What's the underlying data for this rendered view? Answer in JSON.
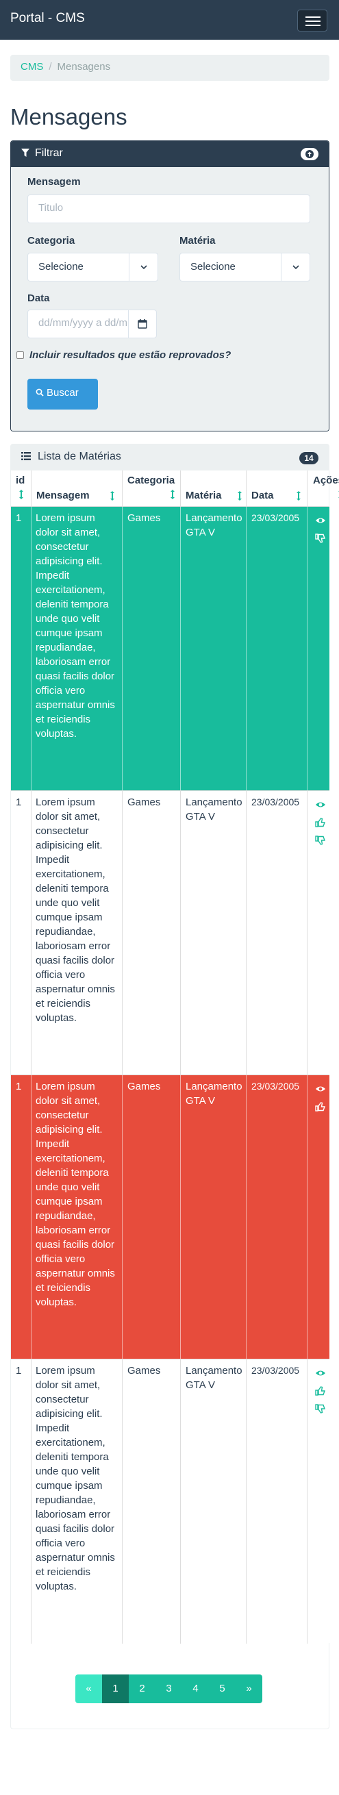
{
  "navbar": {
    "brand": "Portal - CMS"
  },
  "breadcrumb": {
    "root": "CMS",
    "separator": "/",
    "current": "Mensagens"
  },
  "page": {
    "title": "Mensagens"
  },
  "filter": {
    "title": "Filtrar",
    "message_label": "Mensagem",
    "message_placeholder": "Titulo",
    "category_label": "Categoria",
    "category_value": "Selecione",
    "subject_label": "Matéria",
    "subject_value": "Selecione",
    "date_label": "Data",
    "date_placeholder": "dd/mm/yyyy a dd/m",
    "include_rejected_label": "Incluir resultados que estão reprovados?",
    "search_button": "Buscar"
  },
  "list": {
    "title": "Lista de Matérias",
    "count": "14",
    "columns": [
      "id",
      "Mensagem",
      "Categoria",
      "Matéria",
      "Data",
      "Ações"
    ],
    "rows": [
      {
        "status": "approved",
        "id": "1",
        "message": "Lorem ipsum dolor sit amet, consectetur adipisicing elit. Impedit exercitationem, deleniti tempora unde quo velit cumque ipsam repudiandae, laboriosam error quasi facilis dolor officia vero aspernatur omnis et reiciendis voluptas.",
        "category": "Games",
        "subject": "Lançamento GTA V",
        "date": "23/03/2005",
        "actions": [
          "eye-icon",
          "thumbs-down-icon"
        ]
      },
      {
        "status": "pending",
        "id": "1",
        "message": "Lorem ipsum dolor sit amet, consectetur adipisicing elit. Impedit exercitationem, deleniti tempora unde quo velit cumque ipsam repudiandae, laboriosam error quasi facilis dolor officia vero aspernatur omnis et reiciendis voluptas.",
        "category": "Games",
        "subject": "Lançamento GTA V",
        "date": "23/03/2005",
        "actions": [
          "eye-icon",
          "thumbs-up-icon",
          "thumbs-down-icon"
        ]
      },
      {
        "status": "rejected",
        "id": "1",
        "message": "Lorem ipsum dolor sit amet, consectetur adipisicing elit. Impedit exercitationem, deleniti tempora unde quo velit cumque ipsam repudiandae, laboriosam error quasi facilis dolor officia vero aspernatur omnis et reiciendis voluptas.",
        "category": "Games",
        "subject": "Lançamento GTA V",
        "date": "23/03/2005",
        "actions": [
          "eye-icon",
          "thumbs-up-icon"
        ]
      },
      {
        "status": "pending",
        "id": "1",
        "message": "Lorem ipsum dolor sit amet, consectetur adipisicing elit. Impedit exercitationem, deleniti tempora unde quo velit cumque ipsam repudiandae, laboriosam error quasi facilis dolor officia vero aspernatur omnis et reiciendis voluptas.",
        "category": "Games",
        "subject": "Lançamento GTA V",
        "date": "23/03/2005",
        "actions": [
          "eye-icon",
          "thumbs-up-icon",
          "thumbs-down-icon"
        ]
      }
    ]
  },
  "pagination": {
    "prev": "«",
    "pages": [
      "1",
      "2",
      "3",
      "4",
      "5"
    ],
    "next": "»",
    "active": "1"
  },
  "colors": {
    "navbar": "#2c3e50",
    "success": "#18bc9c",
    "danger": "#e74c3c",
    "primary": "#3498db",
    "light": "#ecf0f1"
  }
}
